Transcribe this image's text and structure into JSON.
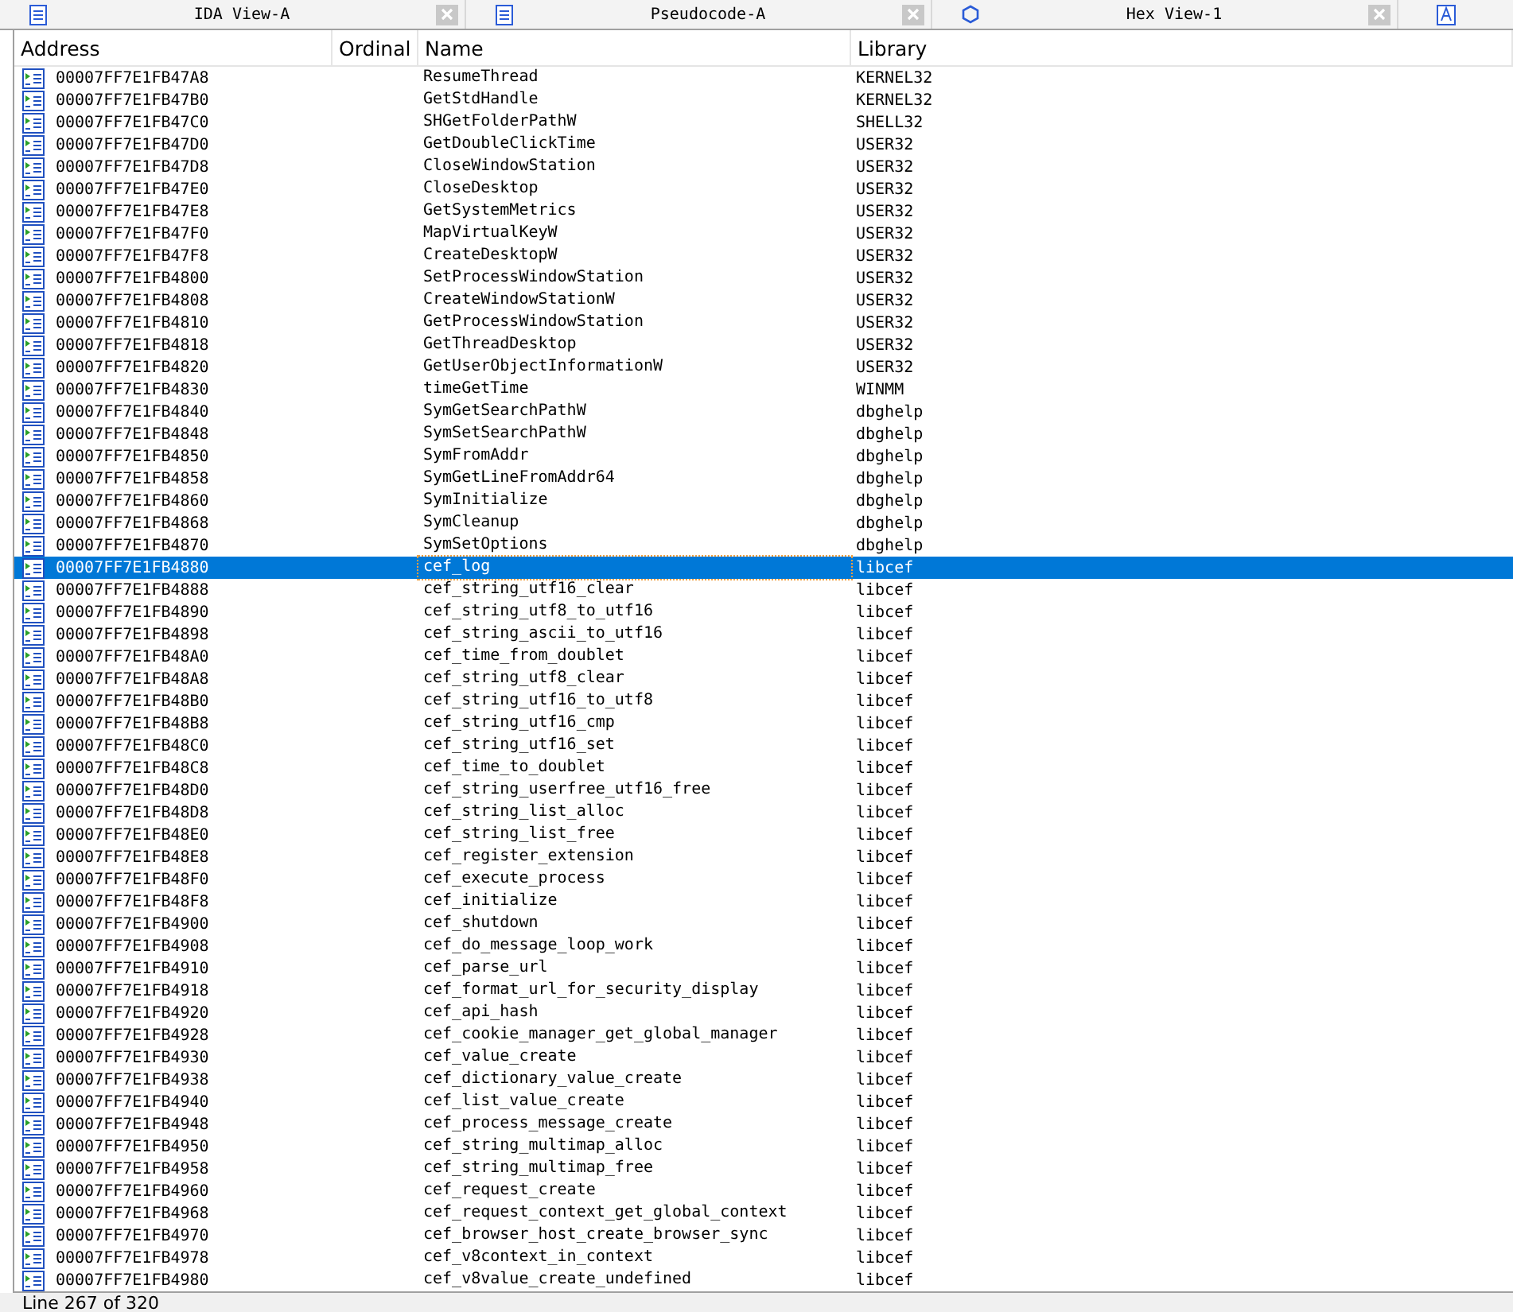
{
  "tabs": [
    {
      "title": "IDA View-A",
      "kind": "listing"
    },
    {
      "title": "Pseudocode-A",
      "kind": "listing"
    },
    {
      "title": "Hex View-1",
      "kind": "hex"
    }
  ],
  "table": {
    "columns": [
      "Address",
      "Ordinal",
      "Name",
      "Library"
    ],
    "rows": [
      {
        "address": "00007FF7E1FB47A8",
        "name": "ResumeThread",
        "library": "KERNEL32",
        "selected": false
      },
      {
        "address": "00007FF7E1FB47B0",
        "name": "GetStdHandle",
        "library": "KERNEL32",
        "selected": false
      },
      {
        "address": "00007FF7E1FB47C0",
        "name": "SHGetFolderPathW",
        "library": "SHELL32",
        "selected": false
      },
      {
        "address": "00007FF7E1FB47D0",
        "name": "GetDoubleClickTime",
        "library": "USER32",
        "selected": false
      },
      {
        "address": "00007FF7E1FB47D8",
        "name": "CloseWindowStation",
        "library": "USER32",
        "selected": false
      },
      {
        "address": "00007FF7E1FB47E0",
        "name": "CloseDesktop",
        "library": "USER32",
        "selected": false
      },
      {
        "address": "00007FF7E1FB47E8",
        "name": "GetSystemMetrics",
        "library": "USER32",
        "selected": false
      },
      {
        "address": "00007FF7E1FB47F0",
        "name": "MapVirtualKeyW",
        "library": "USER32",
        "selected": false
      },
      {
        "address": "00007FF7E1FB47F8",
        "name": "CreateDesktopW",
        "library": "USER32",
        "selected": false
      },
      {
        "address": "00007FF7E1FB4800",
        "name": "SetProcessWindowStation",
        "library": "USER32",
        "selected": false
      },
      {
        "address": "00007FF7E1FB4808",
        "name": "CreateWindowStationW",
        "library": "USER32",
        "selected": false
      },
      {
        "address": "00007FF7E1FB4810",
        "name": "GetProcessWindowStation",
        "library": "USER32",
        "selected": false
      },
      {
        "address": "00007FF7E1FB4818",
        "name": "GetThreadDesktop",
        "library": "USER32",
        "selected": false
      },
      {
        "address": "00007FF7E1FB4820",
        "name": "GetUserObjectInformationW",
        "library": "USER32",
        "selected": false
      },
      {
        "address": "00007FF7E1FB4830",
        "name": "timeGetTime",
        "library": "WINMM",
        "selected": false
      },
      {
        "address": "00007FF7E1FB4840",
        "name": "SymGetSearchPathW",
        "library": "dbghelp",
        "selected": false
      },
      {
        "address": "00007FF7E1FB4848",
        "name": "SymSetSearchPathW",
        "library": "dbghelp",
        "selected": false
      },
      {
        "address": "00007FF7E1FB4850",
        "name": "SymFromAddr",
        "library": "dbghelp",
        "selected": false
      },
      {
        "address": "00007FF7E1FB4858",
        "name": "SymGetLineFromAddr64",
        "library": "dbghelp",
        "selected": false
      },
      {
        "address": "00007FF7E1FB4860",
        "name": "SymInitialize",
        "library": "dbghelp",
        "selected": false
      },
      {
        "address": "00007FF7E1FB4868",
        "name": "SymCleanup",
        "library": "dbghelp",
        "selected": false
      },
      {
        "address": "00007FF7E1FB4870",
        "name": "SymSetOptions",
        "library": "dbghelp",
        "selected": false
      },
      {
        "address": "00007FF7E1FB4880",
        "name": "cef_log",
        "library": "libcef",
        "selected": true
      },
      {
        "address": "00007FF7E1FB4888",
        "name": "cef_string_utf16_clear",
        "library": "libcef",
        "selected": false
      },
      {
        "address": "00007FF7E1FB4890",
        "name": "cef_string_utf8_to_utf16",
        "library": "libcef",
        "selected": false
      },
      {
        "address": "00007FF7E1FB4898",
        "name": "cef_string_ascii_to_utf16",
        "library": "libcef",
        "selected": false
      },
      {
        "address": "00007FF7E1FB48A0",
        "name": "cef_time_from_doublet",
        "library": "libcef",
        "selected": false
      },
      {
        "address": "00007FF7E1FB48A8",
        "name": "cef_string_utf8_clear",
        "library": "libcef",
        "selected": false
      },
      {
        "address": "00007FF7E1FB48B0",
        "name": "cef_string_utf16_to_utf8",
        "library": "libcef",
        "selected": false
      },
      {
        "address": "00007FF7E1FB48B8",
        "name": "cef_string_utf16_cmp",
        "library": "libcef",
        "selected": false
      },
      {
        "address": "00007FF7E1FB48C0",
        "name": "cef_string_utf16_set",
        "library": "libcef",
        "selected": false
      },
      {
        "address": "00007FF7E1FB48C8",
        "name": "cef_time_to_doublet",
        "library": "libcef",
        "selected": false
      },
      {
        "address": "00007FF7E1FB48D0",
        "name": "cef_string_userfree_utf16_free",
        "library": "libcef",
        "selected": false
      },
      {
        "address": "00007FF7E1FB48D8",
        "name": "cef_string_list_alloc",
        "library": "libcef",
        "selected": false
      },
      {
        "address": "00007FF7E1FB48E0",
        "name": "cef_string_list_free",
        "library": "libcef",
        "selected": false
      },
      {
        "address": "00007FF7E1FB48E8",
        "name": "cef_register_extension",
        "library": "libcef",
        "selected": false
      },
      {
        "address": "00007FF7E1FB48F0",
        "name": "cef_execute_process",
        "library": "libcef",
        "selected": false
      },
      {
        "address": "00007FF7E1FB48F8",
        "name": "cef_initialize",
        "library": "libcef",
        "selected": false
      },
      {
        "address": "00007FF7E1FB4900",
        "name": "cef_shutdown",
        "library": "libcef",
        "selected": false
      },
      {
        "address": "00007FF7E1FB4908",
        "name": "cef_do_message_loop_work",
        "library": "libcef",
        "selected": false
      },
      {
        "address": "00007FF7E1FB4910",
        "name": "cef_parse_url",
        "library": "libcef",
        "selected": false
      },
      {
        "address": "00007FF7E1FB4918",
        "name": "cef_format_url_for_security_display",
        "library": "libcef",
        "selected": false
      },
      {
        "address": "00007FF7E1FB4920",
        "name": "cef_api_hash",
        "library": "libcef",
        "selected": false
      },
      {
        "address": "00007FF7E1FB4928",
        "name": "cef_cookie_manager_get_global_manager",
        "library": "libcef",
        "selected": false
      },
      {
        "address": "00007FF7E1FB4930",
        "name": "cef_value_create",
        "library": "libcef",
        "selected": false
      },
      {
        "address": "00007FF7E1FB4938",
        "name": "cef_dictionary_value_create",
        "library": "libcef",
        "selected": false
      },
      {
        "address": "00007FF7E1FB4940",
        "name": "cef_list_value_create",
        "library": "libcef",
        "selected": false
      },
      {
        "address": "00007FF7E1FB4948",
        "name": "cef_process_message_create",
        "library": "libcef",
        "selected": false
      },
      {
        "address": "00007FF7E1FB4950",
        "name": "cef_string_multimap_alloc",
        "library": "libcef",
        "selected": false
      },
      {
        "address": "00007FF7E1FB4958",
        "name": "cef_string_multimap_free",
        "library": "libcef",
        "selected": false
      },
      {
        "address": "00007FF7E1FB4960",
        "name": "cef_request_create",
        "library": "libcef",
        "selected": false
      },
      {
        "address": "00007FF7E1FB4968",
        "name": "cef_request_context_get_global_context",
        "library": "libcef",
        "selected": false
      },
      {
        "address": "00007FF7E1FB4970",
        "name": "cef_browser_host_create_browser_sync",
        "library": "libcef",
        "selected": false
      },
      {
        "address": "00007FF7E1FB4978",
        "name": "cef_v8context_in_context",
        "library": "libcef",
        "selected": false
      },
      {
        "address": "00007FF7E1FB4980",
        "name": "cef_v8value_create_undefined",
        "library": "libcef",
        "selected": false
      }
    ]
  },
  "status_bar": "Line 267 of 320"
}
